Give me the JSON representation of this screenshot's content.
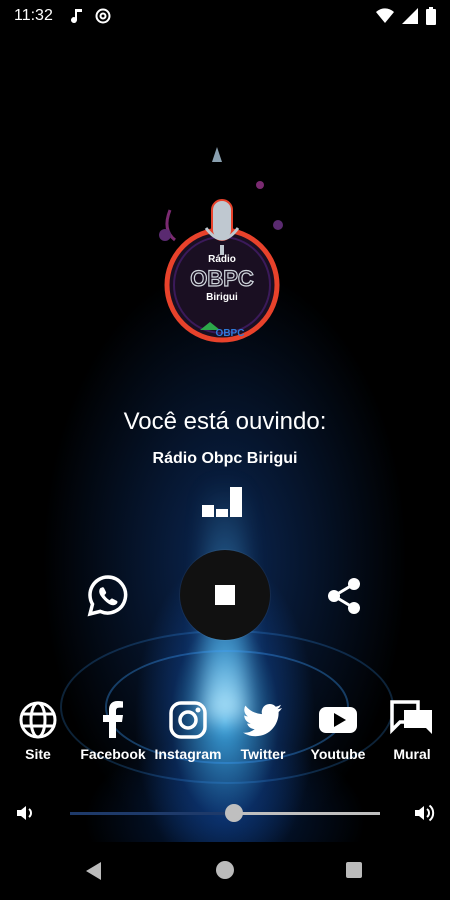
{
  "status_bar": {
    "time": "11:32",
    "left_icons": [
      "music-note-icon",
      "at-sign-icon"
    ],
    "right_icons": [
      "wifi-icon",
      "signal-icon",
      "battery-icon"
    ]
  },
  "logo": {
    "line1": "Rádio",
    "line2": "OBPC",
    "line3": "Birigui",
    "badge": "OBPC"
  },
  "player": {
    "now_playing_label": "Você está ouvindo:",
    "station_name": "Rádio Obpc Birigui",
    "equalizer_icon": "equalizer-icon",
    "whatsapp_icon": "whatsapp-icon",
    "play_state_icon": "stop-icon",
    "share_icon": "share-icon"
  },
  "social": [
    {
      "label": "Site",
      "icon": "globe-icon"
    },
    {
      "label": "Facebook",
      "icon": "facebook-icon"
    },
    {
      "label": "Instagram",
      "icon": "instagram-icon"
    },
    {
      "label": "Twitter",
      "icon": "twitter-icon"
    },
    {
      "label": "Youtube",
      "icon": "youtube-icon"
    },
    {
      "label": "Mural",
      "icon": "chat-icon"
    }
  ],
  "volume": {
    "level_percent": 53
  },
  "colors": {
    "accent_blue": "#3ab4ff",
    "slider_fill": "#1e3a6a",
    "slider_track": "#bfbfbf",
    "logo_ring": "#e8422b"
  }
}
